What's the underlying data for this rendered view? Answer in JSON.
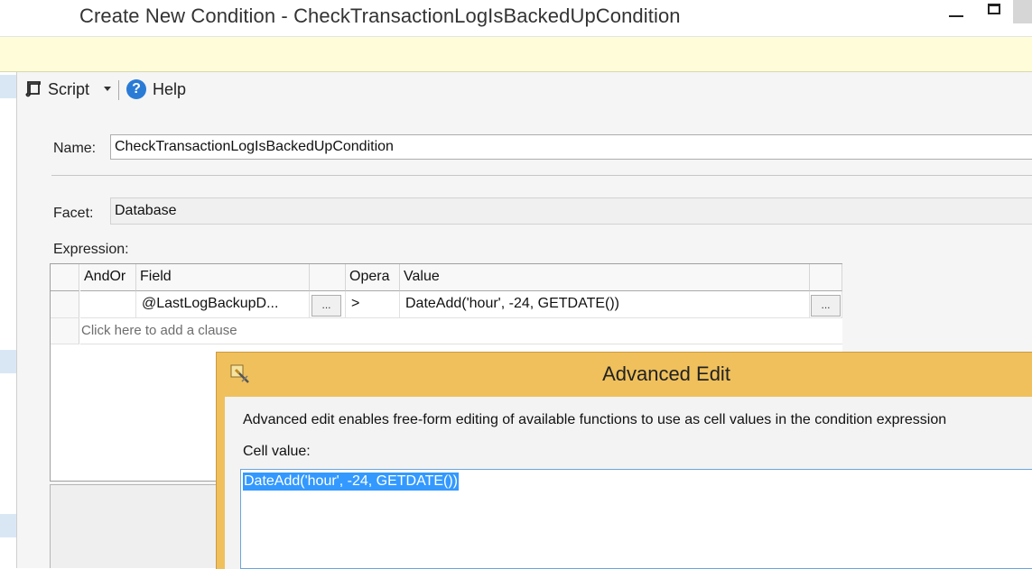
{
  "window": {
    "title": "Create New Condition - CheckTransactionLogIsBackedUpCondition"
  },
  "toolbar": {
    "script_label": "Script",
    "help_label": "Help",
    "help_glyph": "?"
  },
  "form": {
    "name_label": "Name:",
    "name_value": "CheckTransactionLogIsBackedUpCondition",
    "facet_label": "Facet:",
    "facet_value": "Database",
    "expression_label": "Expression:"
  },
  "grid": {
    "columns": [
      "AndOr",
      "Field",
      "Opera",
      "Value"
    ],
    "rows": [
      {
        "andor": "",
        "field": "@LastLogBackupD...",
        "field_button": "...",
        "operator": ">",
        "value": "DateAdd('hour', -24, GETDATE())",
        "value_button": "..."
      }
    ],
    "add_clause_text": "Click here to add a clause"
  },
  "dialog": {
    "title": "Advanced Edit",
    "description": "Advanced edit enables free-form editing of available functions to use as cell values in the condition expression",
    "cell_value_label": "Cell value:",
    "cell_value": "DateAdd('hour', -24, GETDATE())"
  },
  "colors": {
    "info_bar": "#fefcd9",
    "dialog_title_bar": "#efc05c",
    "selection": "#3399ff",
    "help_icon": "#2a7bd6"
  }
}
